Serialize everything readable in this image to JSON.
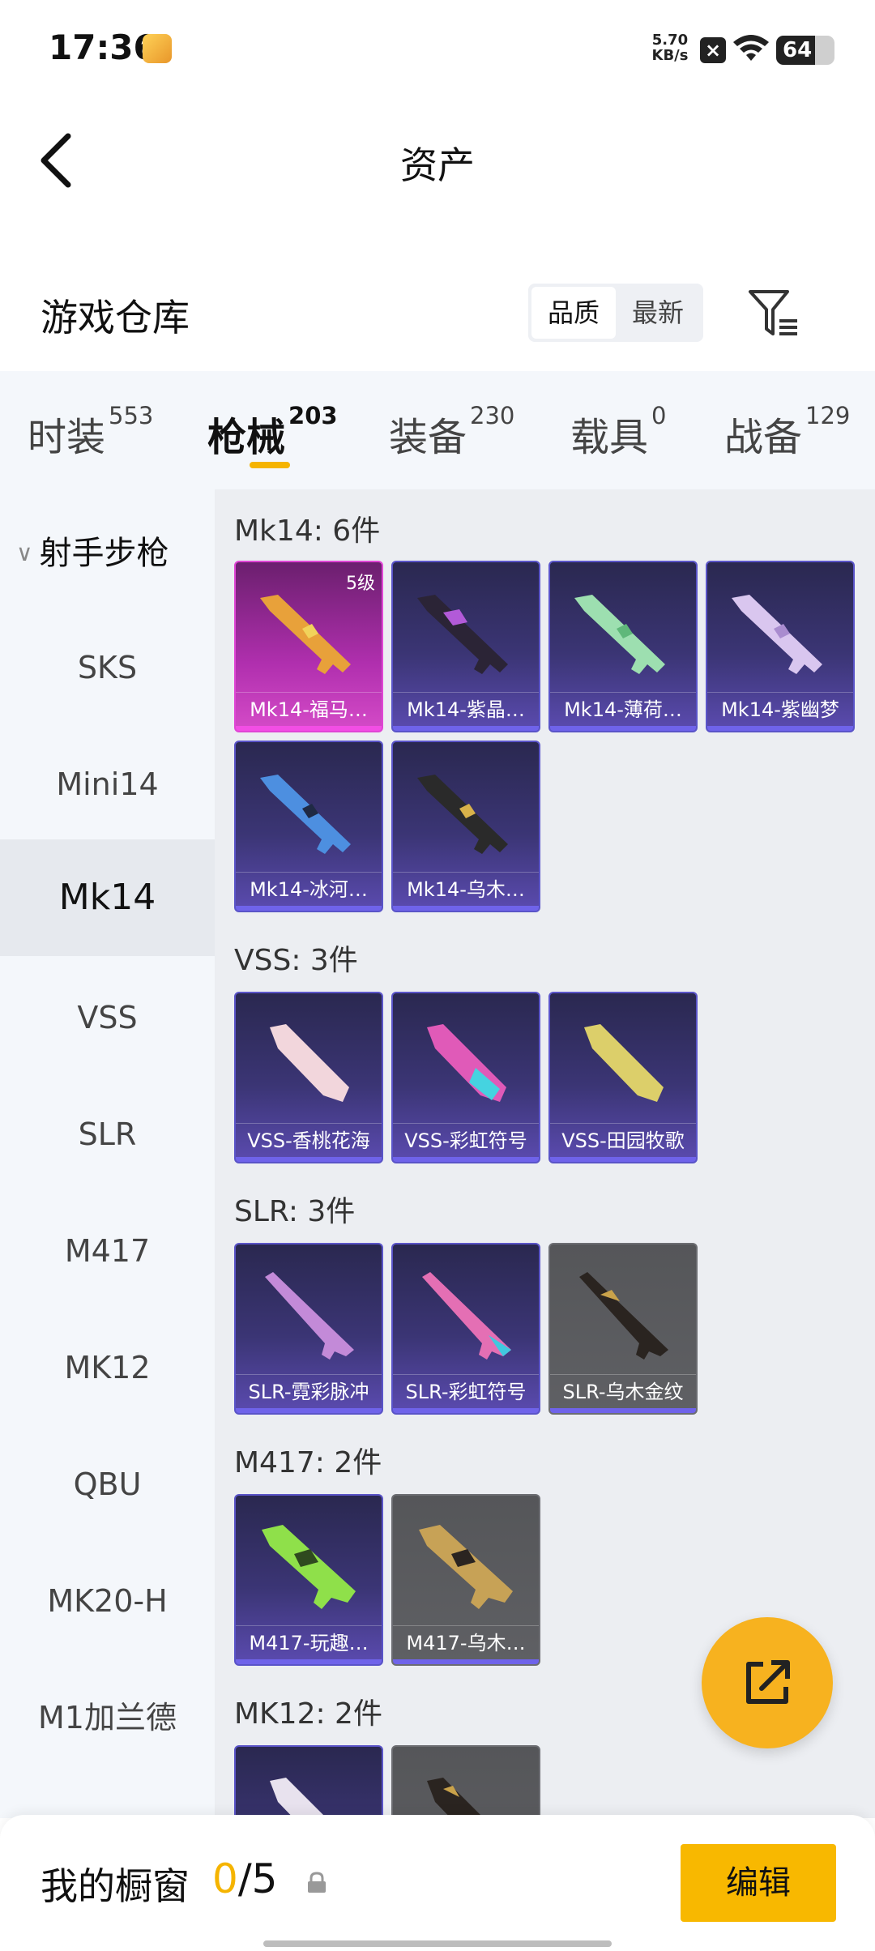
{
  "status_bar": {
    "time": "17:36",
    "net_speed": "5.70",
    "net_unit": "KB/s",
    "battery": "64"
  },
  "nav": {
    "title": "资产"
  },
  "warehouse": {
    "title": "游戏仓库",
    "sort_options": [
      "品质",
      "最新"
    ],
    "active_sort": "品质"
  },
  "tabs": [
    {
      "label": "时装",
      "count": "553"
    },
    {
      "label": "枪械",
      "count": "203"
    },
    {
      "label": "装备",
      "count": "230"
    },
    {
      "label": "载具",
      "count": "0"
    },
    {
      "label": "战备",
      "count": "129"
    }
  ],
  "sidebar": {
    "group": "射手步枪",
    "items": [
      "SKS",
      "Mini14",
      "Mk14",
      "VSS",
      "SLR",
      "M417",
      "MK12",
      "QBU",
      "MK20-H",
      "M1加兰德"
    ],
    "active": "Mk14"
  },
  "groups": [
    {
      "title": "Mk14: 6件",
      "items": [
        {
          "name": "Mk14-福马…",
          "level": "5级",
          "style": "pink"
        },
        {
          "name": "Mk14-紫晶…",
          "style": "purple"
        },
        {
          "name": "Mk14-薄荷…",
          "style": "purple"
        },
        {
          "name": "Mk14-紫幽梦",
          "style": "purple"
        },
        {
          "name": "Mk14-冰河…",
          "style": "purple"
        },
        {
          "name": "Mk14-乌木…",
          "style": "purple"
        }
      ]
    },
    {
      "title": "VSS: 3件",
      "items": [
        {
          "name": "VSS-香桃花海",
          "style": "purple"
        },
        {
          "name": "VSS-彩虹符号",
          "style": "purple"
        },
        {
          "name": "VSS-田园牧歌",
          "style": "purple"
        }
      ]
    },
    {
      "title": "SLR: 3件",
      "items": [
        {
          "name": "SLR-霓彩脉冲",
          "style": "purple"
        },
        {
          "name": "SLR-彩虹符号",
          "style": "purple"
        },
        {
          "name": "SLR-乌木金纹",
          "style": "gray"
        }
      ]
    },
    {
      "title": "M417: 2件",
      "items": [
        {
          "name": "M417-玩趣…",
          "style": "purple"
        },
        {
          "name": "M417-乌木…",
          "style": "gray"
        }
      ]
    },
    {
      "title": "MK12: 2件",
      "items": [
        {
          "name": "",
          "style": "purple"
        },
        {
          "name": "",
          "style": "gray"
        }
      ]
    }
  ],
  "bottom": {
    "label": "我的橱窗",
    "current": "0",
    "total": "/5",
    "edit_label": "编辑"
  }
}
